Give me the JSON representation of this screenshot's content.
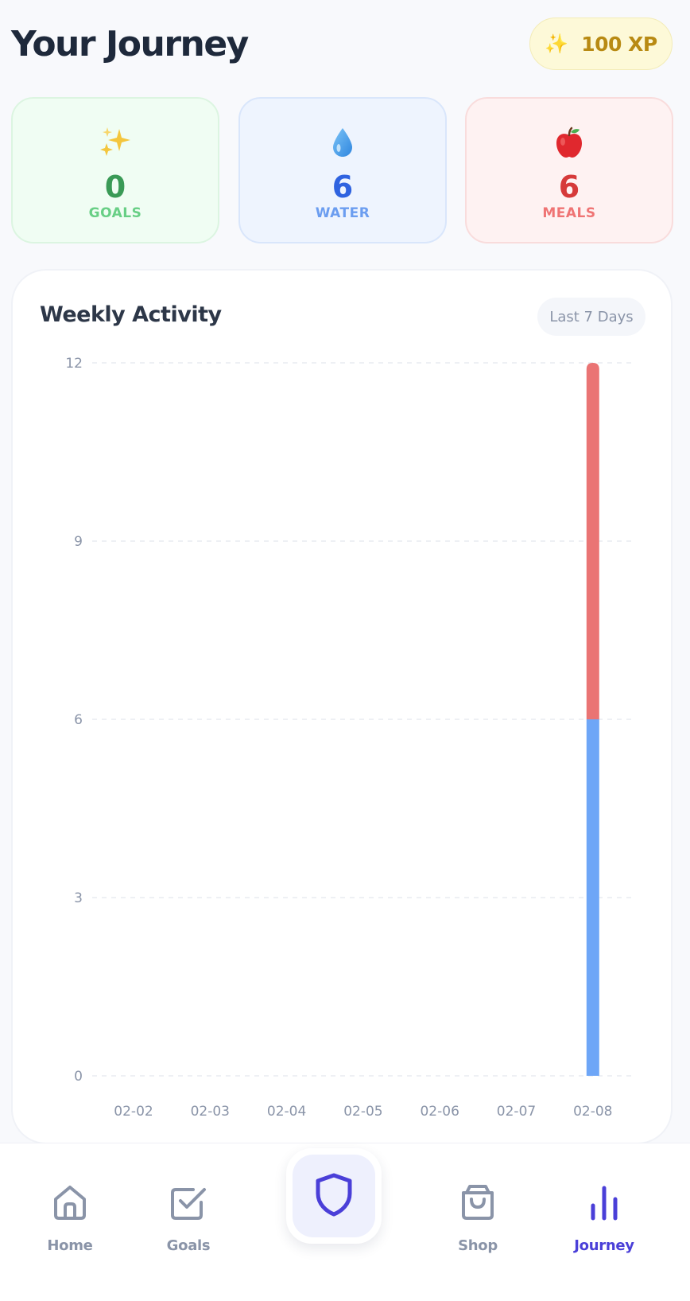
{
  "header": {
    "title": "Your Journey",
    "xp_icon": "sparkles-icon",
    "xp_label": "100 XP"
  },
  "stats": {
    "goals": {
      "icon": "sparkles-icon",
      "value": "0",
      "label": "GOALS"
    },
    "water": {
      "icon": "water-drop-icon",
      "value": "6",
      "label": "WATER"
    },
    "meals": {
      "icon": "apple-icon",
      "value": "6",
      "label": "MEALS"
    }
  },
  "activity": {
    "title": "Weekly Activity",
    "range_label": "Last 7 Days"
  },
  "chart_data": {
    "type": "bar",
    "stacked": true,
    "categories": [
      "02-02",
      "02-03",
      "02-04",
      "02-05",
      "02-06",
      "02-07",
      "02-08"
    ],
    "series": [
      {
        "color": "#6ea6f7",
        "values": [
          0,
          0,
          0,
          0,
          0,
          0,
          6
        ]
      },
      {
        "color": "#ea7474",
        "values": [
          0,
          0,
          0,
          0,
          0,
          0,
          6
        ]
      }
    ],
    "yticks": [
      0,
      3,
      6,
      9,
      12
    ],
    "ylim": [
      0,
      12
    ],
    "grid": true,
    "title": "",
    "xlabel": "",
    "ylabel": ""
  },
  "nav": {
    "home": {
      "label": "Home",
      "icon": "home-icon"
    },
    "goals": {
      "label": "Goals",
      "icon": "checkbox-icon"
    },
    "center": {
      "icon": "shield-icon"
    },
    "shop": {
      "label": "Shop",
      "icon": "shopping-bag-icon"
    },
    "journey": {
      "label": "Journey",
      "icon": "bar-chart-icon",
      "active": true
    }
  },
  "colors": {
    "accent": "#4a3fd8",
    "water_bar": "#6ea6f7",
    "meals_bar": "#ea7474"
  }
}
